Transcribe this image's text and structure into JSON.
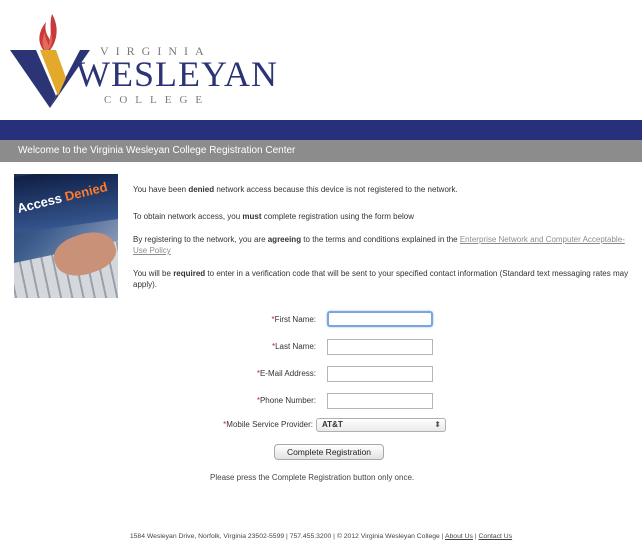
{
  "logo": {
    "line1": "VIRGINIA",
    "line2": "WESLEYAN",
    "line3": "COLLEGE",
    "flame_color": "#c8393a",
    "brand_color": "#2b3475",
    "gold_color": "#e2a92b"
  },
  "header": {
    "welcome": "Welcome to the Virginia Wesleyan College Registration Center"
  },
  "photo": {
    "text_a": "Access",
    "text_b": "Denied"
  },
  "messages": {
    "m1_pre": "You have been ",
    "m1_bold": "denied",
    "m1_post": " network access because this device is not registered to the network.",
    "m2_pre": "To obtain network access, you ",
    "m2_bold": "must",
    "m2_post": " complete registration using the form below",
    "m3_pre": "By registering to the network, you are ",
    "m3_bold": "agreeing",
    "m3_post": " to the terms and conditions explained in the ",
    "m3_link": "Enterprise Network and Computer Acceptable-Use Policy",
    "m4_pre": "You will be ",
    "m4_bold": "required",
    "m4_post": " to enter in a verification code that will be sent to your specified contact information (Standard text messaging rates may apply)."
  },
  "form": {
    "required_mark": "*",
    "first_name_label": "First Name:",
    "last_name_label": "Last Name:",
    "email_label": "E-Mail Address:",
    "phone_label": "Phone Number:",
    "provider_label": "Mobile Service Provider:",
    "first_name_value": "",
    "last_name_value": "",
    "email_value": "",
    "phone_value": "",
    "provider_selected": "AT&T",
    "submit_label": "Complete Registration",
    "note": "Please press the Complete Registration button only once."
  },
  "footer": {
    "address": "1584 Wesleyan Drive, Norfolk,  Virginia 23502-5599  |  757.455.3200  |  © 2012 Virginia Wesleyan College  |  ",
    "about": "About Us",
    "sep": "  |  ",
    "contact": "Contact Us"
  }
}
